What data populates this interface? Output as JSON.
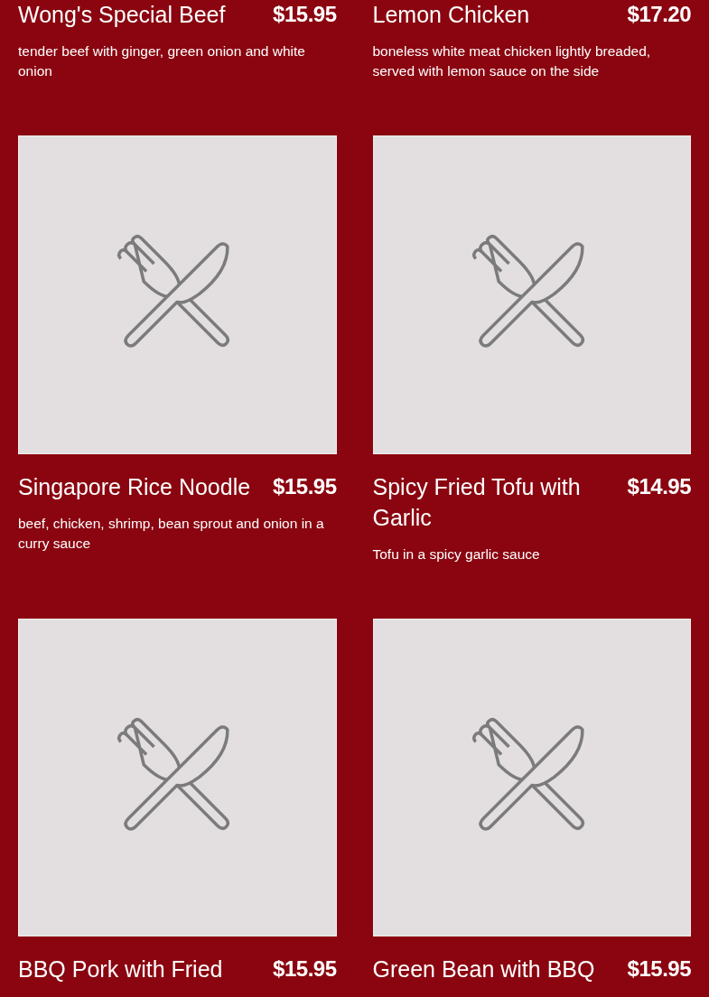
{
  "menu_items": [
    {
      "name": "Wong's Special Beef",
      "price": "$15.95",
      "description": "tender beef with ginger, green onion and white onion"
    },
    {
      "name": "Lemon Chicken",
      "price": "$17.20",
      "description": "boneless white meat chicken lightly breaded, served with lemon sauce on the side"
    },
    {
      "name": "Singapore Rice Noodle",
      "price": "$15.95",
      "description": "beef, chicken, shrimp, bean sprout and onion in a curry sauce",
      "placeholder_image": true
    },
    {
      "name": "Spicy Fried Tofu with Garlic",
      "price": "$14.95",
      "description": "Tofu in a spicy garlic sauce",
      "placeholder_image": true
    },
    {
      "name": "BBQ Pork with Fried",
      "price": "$15.95",
      "placeholder_image": true
    },
    {
      "name": "Green Bean with BBQ",
      "price": "$15.95",
      "placeholder_image": true
    }
  ]
}
